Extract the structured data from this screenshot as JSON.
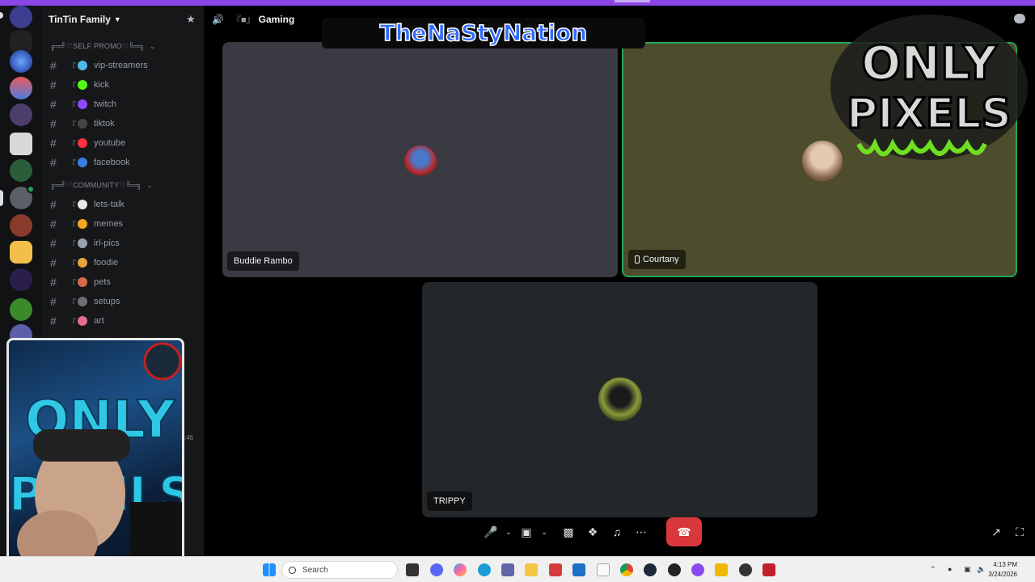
{
  "guild": {
    "name": "TinTin Family"
  },
  "categories": {
    "self_promo": "╔═╝♡SELF PROMO♡╚═╗",
    "community": "╔═╝♡COMMUNITY♡╚═╗"
  },
  "channels": [
    {
      "label": "vip-streamers",
      "color": "#4fb6e8"
    },
    {
      "label": "kick",
      "color": "#53fc18"
    },
    {
      "label": "twitch",
      "color": "#9146ff"
    },
    {
      "label": "tiktok",
      "color": "#444444"
    },
    {
      "label": "youtube",
      "color": "#ff3040"
    },
    {
      "label": "facebook",
      "color": "#3b7de3"
    },
    {
      "label": "lets-talk",
      "color": "#e8e8e8"
    },
    {
      "label": "memes",
      "color": "#f5a623"
    },
    {
      "label": "irl-pics",
      "color": "#9aa3ad"
    },
    {
      "label": "foodie",
      "color": "#e7a23a"
    },
    {
      "label": "pets",
      "color": "#d86a4a"
    },
    {
      "label": "setups",
      "color": "#6e7075"
    },
    {
      "label": "art",
      "color": "#e36d8c"
    }
  ],
  "call": {
    "channel": "Gaming",
    "participants": [
      {
        "name": "Buddie Rambo"
      },
      {
        "name": "Courtany"
      },
      {
        "name": "TRIPPY"
      }
    ]
  },
  "overlay": {
    "banner": "TheNaStyNation",
    "logo_line1": "ONLY",
    "logo_line2": "PIXELS",
    "webcam_text_1": "ONLY",
    "webcam_text_2": "PIXELS"
  },
  "taskbar": {
    "search_placeholder": "Search",
    "time": "4:13 PM",
    "date": "3/24/2026"
  },
  "misc": {
    "timestamp_peek": ":46"
  },
  "colors": {
    "accent": "#8a45e6",
    "speaking": "#23a55a",
    "hangup": "#da373c"
  }
}
